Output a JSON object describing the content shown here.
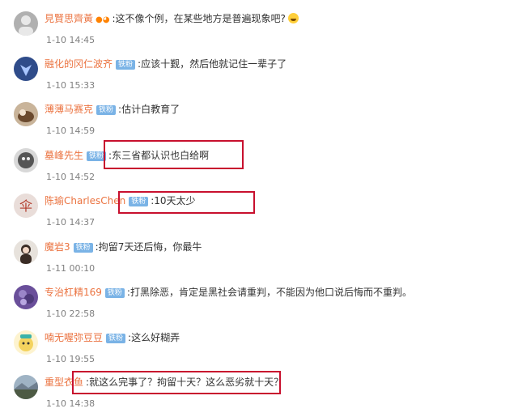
{
  "comments": [
    {
      "user": "見賢思齊黃",
      "badge": "",
      "vip": "●◕",
      "text": "这不像个例，在某些地方是普遍现象吧?",
      "emoji": "smile-emoji",
      "time": "1-10 14:45",
      "avatar_color": "#b0b0b0"
    },
    {
      "user": "融化的冈仁波齐",
      "badge": "铁粉",
      "text": "应该十觐，然后他就记住一辈子了",
      "time": "1-10 15:33",
      "avatar_color": "#2f4c8a"
    },
    {
      "user": "薄薄马赛克",
      "badge": "铁粉",
      "text": "估计白教育了",
      "time": "1-10 14:59",
      "avatar_color": "#8a6e55"
    },
    {
      "user": "墓峰先生",
      "badge": "铁粉",
      "text": "东三省都认识也白给啊",
      "time": "1-10 14:52",
      "avatar_color": "#6d6d6d"
    },
    {
      "user": "陈瑜CharlesChen",
      "badge": "铁粉",
      "text": "10天太少",
      "time": "1-10 14:37",
      "avatar_color": "#b23a2a"
    },
    {
      "user": "魔岩3",
      "badge": "铁粉",
      "text": "拘留7天还后悔，你最牛",
      "time": "1-11 00:10",
      "avatar_color": "#c9b7a8"
    },
    {
      "user": "专治杠精169",
      "badge": "铁粉",
      "text": "打黑除恶，肯定是黑社会请重判，不能因为他口说后悔而不重判。",
      "time": "1-10 22:58",
      "avatar_color": "#6a4f9a"
    },
    {
      "user": "喃无喔弥豆豆",
      "badge": "铁粉",
      "text": "这么好糊弄",
      "time": "1-10 19:55",
      "avatar_color": "#e8c84a"
    },
    {
      "user": "重型衣鱼",
      "badge": "",
      "text": "就这么完事了？拘留十天？这么恶劣就十天？",
      "time": "1-10 14:38",
      "avatar_color": "#5a6b7a"
    }
  ]
}
